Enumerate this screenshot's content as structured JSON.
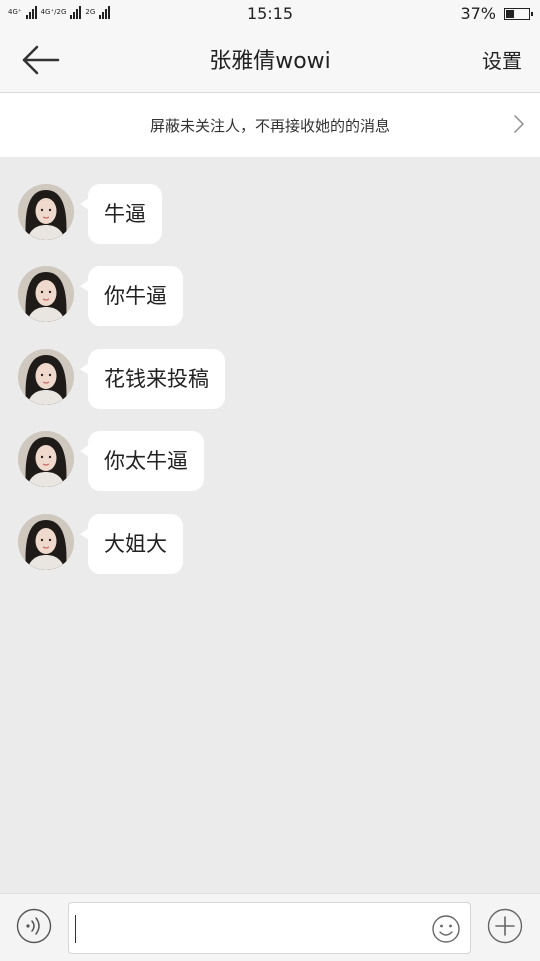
{
  "status_bar": {
    "network_1": "4G⁺",
    "network_2": "4G⁺/2G",
    "network_3": "2G",
    "time": "15:15",
    "battery_text": "37%",
    "battery_level": 0.37
  },
  "header": {
    "title": "张雅倩wowi",
    "settings_label": "设置",
    "back_icon": "arrow-left-icon"
  },
  "notice": {
    "text": "屏蔽未关注人，不再接收她的的消息",
    "icon": "chevron-right-icon"
  },
  "messages": [
    {
      "text": "牛逼"
    },
    {
      "text": "你牛逼"
    },
    {
      "text": "花钱来投稿"
    },
    {
      "text": "你太牛逼"
    },
    {
      "text": "大姐大"
    }
  ],
  "input_bar": {
    "voice_icon": "voice-icon",
    "emoji_icon": "emoji-icon",
    "plus_icon": "plus-icon",
    "input_value": ""
  },
  "colors": {
    "background": "#ebebeb",
    "bubble": "#ffffff",
    "bar": "#f7f7f7"
  }
}
